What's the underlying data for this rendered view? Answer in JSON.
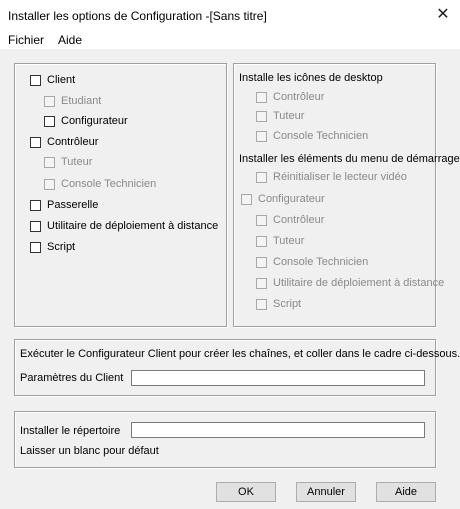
{
  "window": {
    "title": "Installer les options de Configuration -[Sans titre]",
    "close_glyph": "✕"
  },
  "menu": {
    "file": "Fichier",
    "help": "Aide"
  },
  "components": {
    "client": "Client",
    "etudiant": "Etudiant",
    "configurateur": "Configurateur",
    "controleur": "Contrôleur",
    "tuteur": "Tuteur",
    "console_technicien": "Console Technicien",
    "passerelle": "Passerelle",
    "utilitaire": "Utilitaire de déploiement à distance",
    "script": "Script"
  },
  "desktop": {
    "heading": "Installe les icônes de desktop",
    "controleur": "Contrôleur",
    "tuteur": "Tuteur",
    "console": "Console Technicien"
  },
  "start_menu": {
    "heading": "Installer les éléments du menu de démarrage",
    "reset_video": "Réinitialiser le lecteur vidéo",
    "configurateur": "Configurateur",
    "controleur": "Contrôleur",
    "tuteur": "Tuteur",
    "console": "Console Technicien",
    "utilitaire": "Utilitaire de déploiement à distance",
    "script": "Script"
  },
  "client_params": {
    "instruction": "Exécuter le Configurateur Client pour créer les chaînes, et coller dans le cadre ci-dessous.",
    "label": "Paramètres du Client",
    "value": ""
  },
  "install_dir": {
    "label": "Installer le répertoire",
    "hint": "Laisser un blanc pour défaut",
    "value": ""
  },
  "buttons": {
    "ok": "OK",
    "cancel": "Annuler",
    "help": "Aide"
  }
}
